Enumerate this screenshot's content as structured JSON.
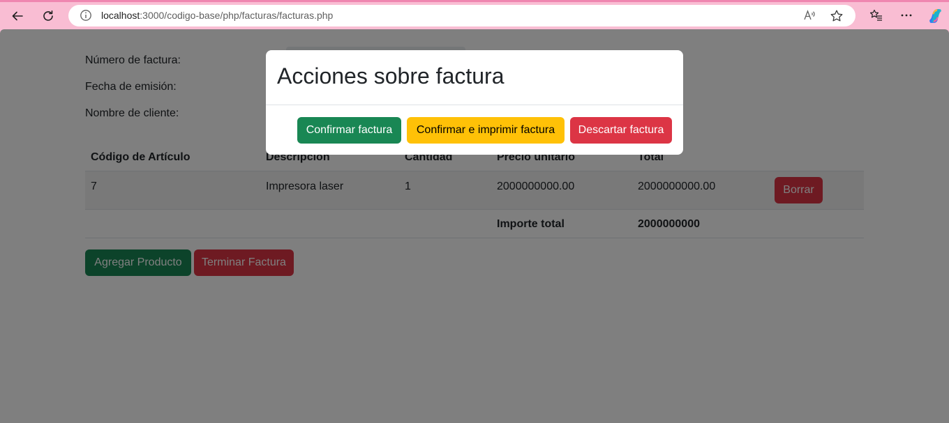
{
  "browser": {
    "url_host": "localhost",
    "url_rest": ":3000/codigo-base/php/facturas/facturas.php"
  },
  "form": {
    "invoice_number_label": "Número de factura:",
    "issue_date_label": "Fecha de emisión:",
    "client_name_label": "Nombre de cliente:"
  },
  "table": {
    "headers": [
      "Código de Artículo",
      "Descripcion",
      "Cantidad",
      "Precio unitario",
      "Total"
    ],
    "rows": [
      {
        "code": "7",
        "description": "Impresora laser",
        "quantity": "1",
        "unit_price": "2000000000.00",
        "total": "2000000000.00",
        "delete_label": "Borrar"
      }
    ],
    "footer": {
      "label": "Importe total",
      "value": "2000000000"
    }
  },
  "actions": {
    "add_product": "Agregar Producto",
    "finish_invoice": "Terminar Factura"
  },
  "modal": {
    "title": "Acciones sobre factura",
    "confirm": "Confirmar factura",
    "confirm_print": "Confirmar e imprimir factura",
    "discard": "Descartar factura"
  },
  "colors": {
    "success": "#198754",
    "warning": "#ffc107",
    "danger": "#dc3545",
    "browser_frame": "#f9bdd3"
  }
}
